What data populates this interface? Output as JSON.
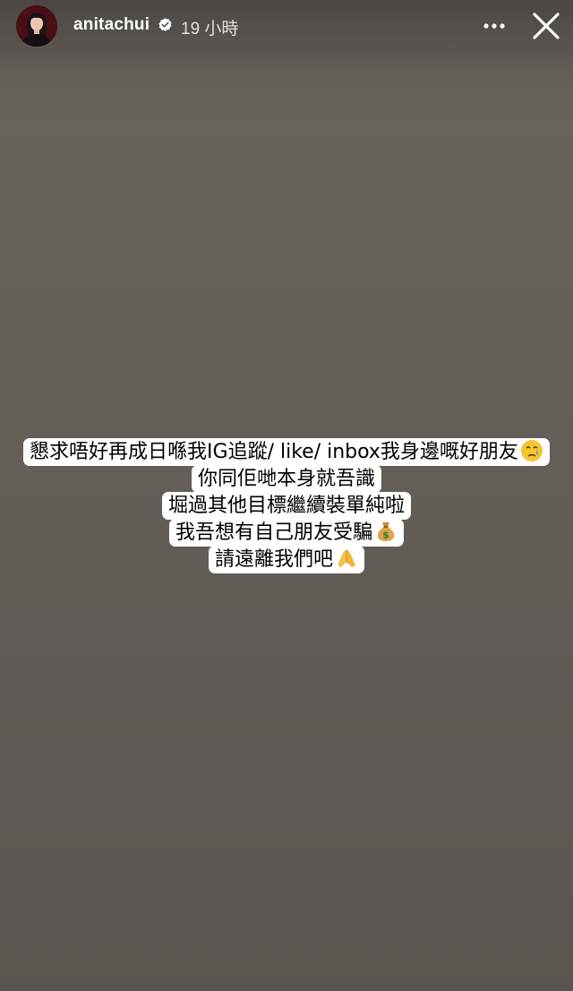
{
  "header": {
    "username": "anitachui",
    "time": "19 小時",
    "verified": true
  },
  "icons": {
    "more": "more-horizontal-icon",
    "close": "close-icon",
    "verified": "verified-badge-icon"
  },
  "caption": {
    "lines": [
      {
        "text": "懇求唔好再成日喺我IG追蹤/ like/ inbox我身邊嘅好朋友",
        "emoji": "crying-face-emoji"
      },
      {
        "text": "你同佢哋本身就吾識",
        "emoji": ""
      },
      {
        "text": "堀過其他目標繼續裝單純啦",
        "emoji": ""
      },
      {
        "text": "我吾想有自己朋友受騙",
        "emoji": "money-bag-emoji"
      },
      {
        "text": "請遠離我們吧",
        "emoji": "folded-hands-emoji"
      }
    ]
  },
  "colors": {
    "background": "#645f59",
    "caption_bg": "#ffffff",
    "caption_text": "#000000",
    "verified_badge": "#ffffff",
    "avatar_bg": "#4a0f16"
  }
}
